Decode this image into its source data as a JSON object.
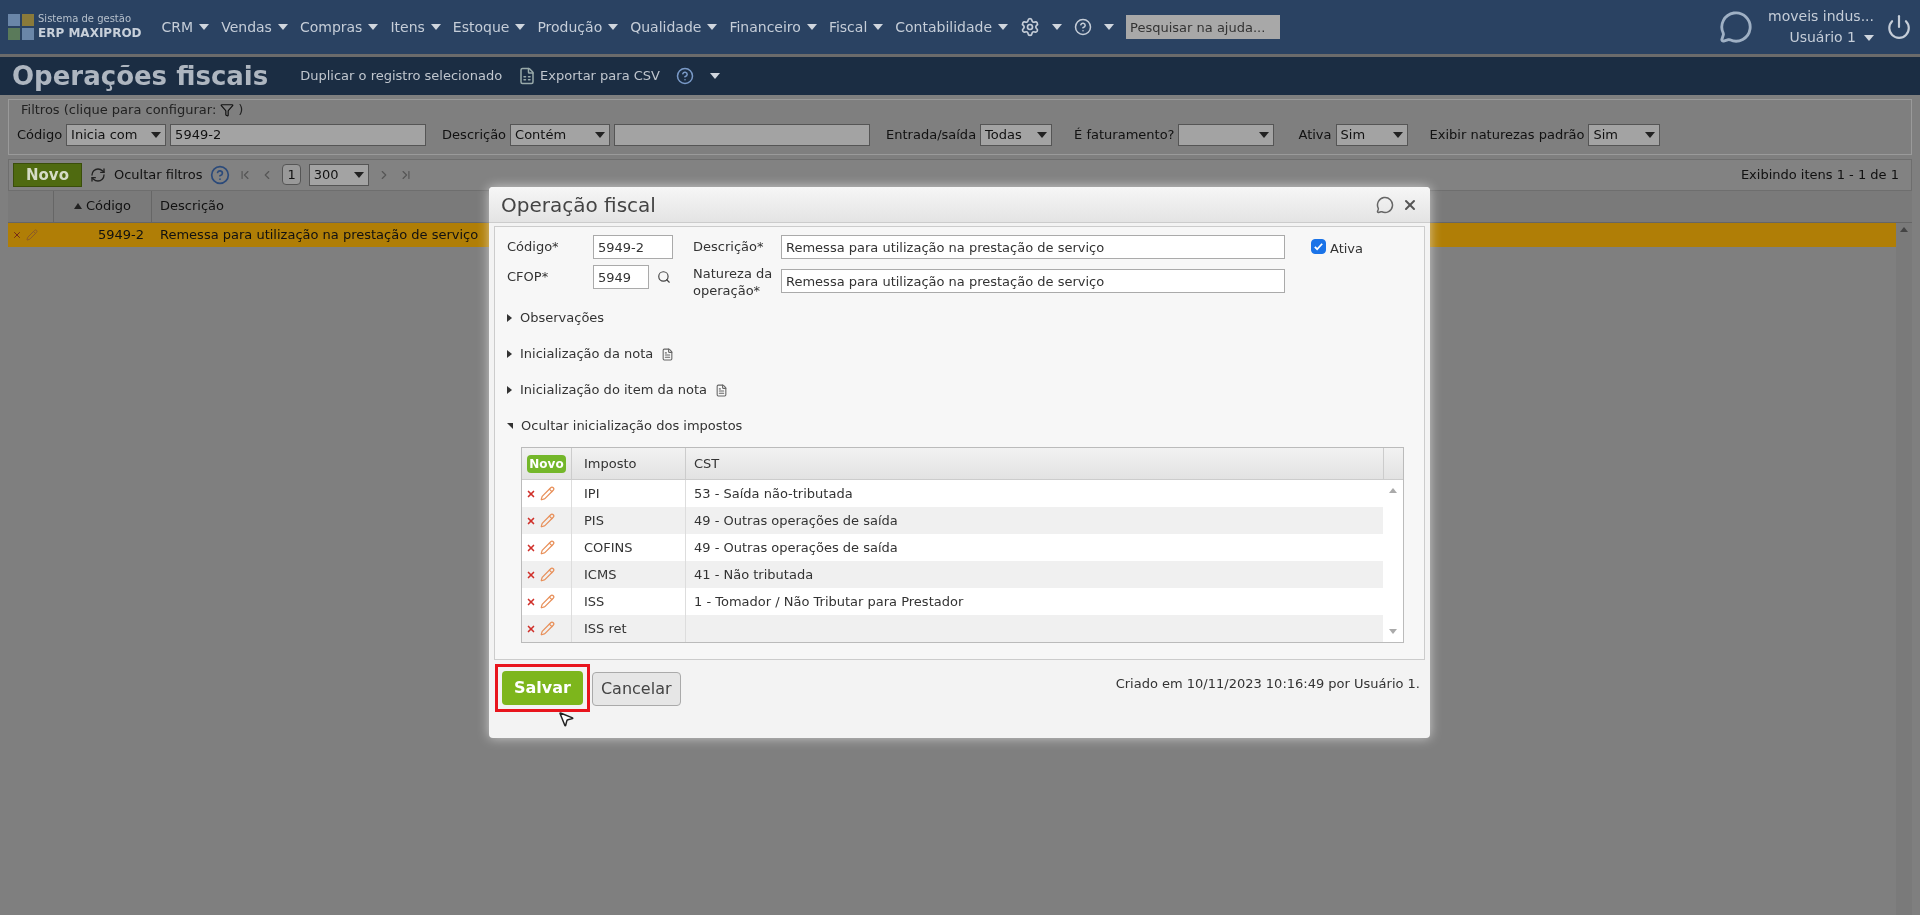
{
  "brand": {
    "line1": "Sistema de gestão",
    "line2": "ERP MAXIPROD"
  },
  "menu": [
    "CRM",
    "Vendas",
    "Compras",
    "Itens",
    "Estoque",
    "Produção",
    "Qualidade",
    "Financeiro",
    "Fiscal",
    "Contabilidade"
  ],
  "help_search": {
    "placeholder": "Pesquisar na ajuda..."
  },
  "user": {
    "company": "moveis indus...",
    "name": "Usuário 1"
  },
  "page": {
    "title": "Operações fiscais",
    "actions": [
      "Duplicar o registro selecionado",
      "Exportar para CSV"
    ]
  },
  "filters": {
    "legend": "Filtros (clique para configurar:",
    "legend_end": ")",
    "fields": [
      {
        "kind": "select_input",
        "label": "Código",
        "select": "Inicia com",
        "value": "5949-2"
      },
      {
        "kind": "select_input",
        "label": "Descrição",
        "select": "Contém"
      },
      {
        "kind": "select",
        "label": "Entrada/saída",
        "select": "Todas"
      },
      {
        "kind": "select",
        "label": "É faturamento?"
      },
      {
        "kind": "select",
        "label": "Ativa",
        "select": "Sim"
      },
      {
        "kind": "select",
        "label": "Exibir naturezas padrão",
        "select": "Sim"
      }
    ]
  },
  "toolbar": {
    "new": "Novo",
    "hide_filters": "Ocultar filtros",
    "page": "1",
    "page_size": "300",
    "status": "Exibindo itens 1 - 1 de 1"
  },
  "table": {
    "columns": [
      "Código",
      "Descrição"
    ],
    "rows": [
      {
        "code": "5949-2",
        "description": "Remessa para utilização na prestação de serviço",
        "selected": true
      }
    ]
  },
  "dialog": {
    "title": "Operação fiscal",
    "code_label": "Código*",
    "code": "5949-2",
    "desc_label": "Descrição*",
    "description": "Remessa para utilização na prestação de serviço",
    "active_label": "Ativa",
    "active": true,
    "cfop_label": "CFOP*",
    "cfop": "5949",
    "nature_label": "Natureza da operação*",
    "nature": "Remessa para utilização na prestação de serviço",
    "sections": [
      {
        "label": "Observações",
        "expanded": false,
        "has_note": false
      },
      {
        "label": "Inicialização da nota",
        "expanded": false,
        "has_note": true
      },
      {
        "label": "Inicialização do item da nota",
        "expanded": false,
        "has_note": true
      },
      {
        "label": "Ocultar inicialização dos impostos",
        "expanded": true,
        "has_note": false
      }
    ],
    "tax_table": {
      "new": "Novo",
      "columns": [
        "Imposto",
        "CST"
      ],
      "rows": [
        {
          "tax": "IPI",
          "cst": "53 - Saída não-tributada"
        },
        {
          "tax": "PIS",
          "cst": "49 - Outras operações de saída"
        },
        {
          "tax": "COFINS",
          "cst": "49 - Outras operações de saída"
        },
        {
          "tax": "ICMS",
          "cst": "41 - Não tributada"
        },
        {
          "tax": "ISS",
          "cst": "1 - Tomador / Não Tributar para Prestador"
        },
        {
          "tax": "ISS ret"
        }
      ]
    },
    "save": "Salvar",
    "cancel": "Cancelar",
    "created": "Criado em 10/11/2023 10:16:49 por Usuário 1."
  }
}
